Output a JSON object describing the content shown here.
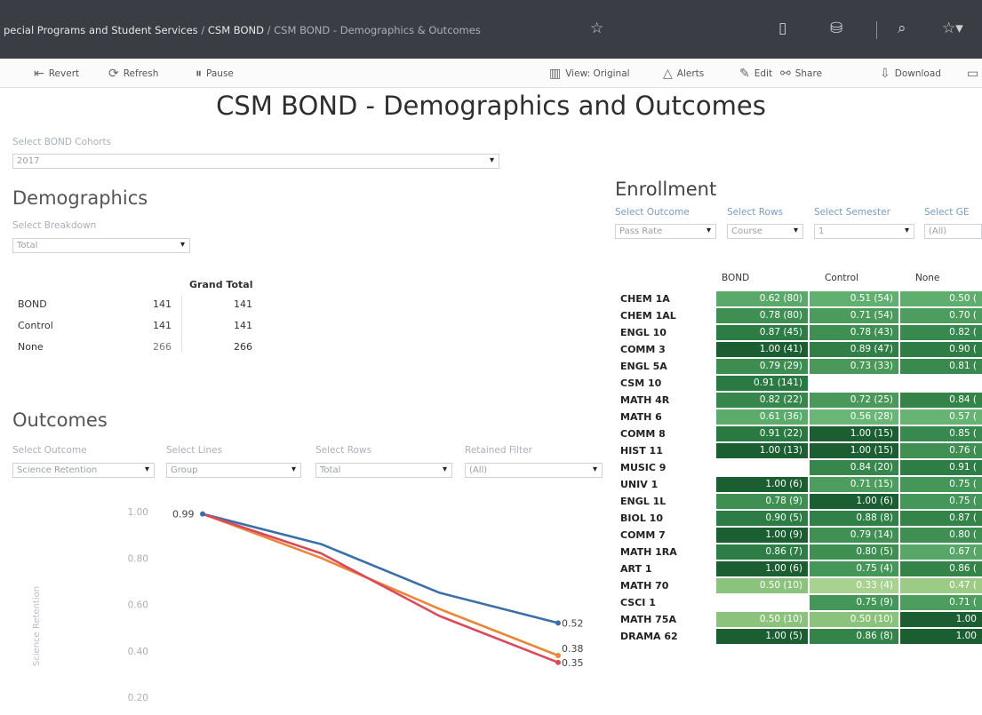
{
  "breadcrumb": {
    "part1": "pecial Programs and Student Services",
    "sep": " / ",
    "part2": "CSM BOND",
    "part3": "CSM BOND - Demographics & Outcomes"
  },
  "toolbar": {
    "revert": "Revert",
    "refresh": "Refresh",
    "pause": "Pause",
    "view_original": "View: Original",
    "alerts": "Alerts",
    "edit": "Edit",
    "share": "Share",
    "download": "Download"
  },
  "title": "CSM BOND - Demographics and Outcomes",
  "cohort_filter": {
    "label": "Select BOND Cohorts",
    "value": "2017"
  },
  "demographics": {
    "title": "Demographics",
    "breakdown_label": "Select Breakdown",
    "breakdown_value": "Total",
    "grand_total_header": "Grand Total",
    "rows": [
      {
        "label": "BOND",
        "value": "141",
        "total": "141"
      },
      {
        "label": "Control",
        "value": "141",
        "total": "141"
      },
      {
        "label": "None",
        "value": "266",
        "total": "266"
      }
    ]
  },
  "outcomes": {
    "title": "Outcomes",
    "filters": [
      {
        "label": "Select Outcome",
        "value": "Science Retention"
      },
      {
        "label": "Select Lines",
        "value": "Group"
      },
      {
        "label": "Select Rows",
        "value": "Total"
      },
      {
        "label": "Retained Filter",
        "value": "(All)"
      }
    ]
  },
  "enrollment": {
    "title": "Enrollment",
    "filters": [
      {
        "label": "Select Outcome",
        "value": "Pass Rate"
      },
      {
        "label": "Select Rows",
        "value": "Course"
      },
      {
        "label": "Select Semester",
        "value": "1"
      },
      {
        "label": "Select GE",
        "value": "(All)"
      }
    ],
    "columns": [
      "BOND",
      "Control",
      "None"
    ],
    "rows": [
      {
        "course": "CHEM 1A",
        "cells": [
          "0.62 (80)",
          "0.51 (54)",
          "0.50 ("
        ]
      },
      {
        "course": "CHEM 1AL",
        "cells": [
          "0.78 (80)",
          "0.71 (54)",
          "0.70 ("
        ]
      },
      {
        "course": "ENGL 10",
        "cells": [
          "0.87 (45)",
          "0.78 (43)",
          "0.82 ("
        ]
      },
      {
        "course": "COMM 3",
        "cells": [
          "1.00 (41)",
          "0.89 (47)",
          "0.90 ("
        ]
      },
      {
        "course": "ENGL 5A",
        "cells": [
          "0.79 (29)",
          "0.73 (33)",
          "0.81 ("
        ]
      },
      {
        "course": "CSM 10",
        "cells": [
          "0.91 (141)",
          "",
          ""
        ]
      },
      {
        "course": "MATH 4R",
        "cells": [
          "0.82 (22)",
          "0.72 (25)",
          "0.84 ("
        ]
      },
      {
        "course": "MATH 6",
        "cells": [
          "0.61 (36)",
          "0.56 (28)",
          "0.57 ("
        ]
      },
      {
        "course": "COMM 8",
        "cells": [
          "0.91 (22)",
          "1.00 (15)",
          "0.85 ("
        ]
      },
      {
        "course": "HIST 11",
        "cells": [
          "1.00 (13)",
          "1.00 (15)",
          "0.76 ("
        ]
      },
      {
        "course": "MUSIC 9",
        "cells": [
          "",
          "0.84 (20)",
          "0.91 ("
        ]
      },
      {
        "course": "UNIV 1",
        "cells": [
          "1.00 (6)",
          "0.71 (15)",
          "0.75 ("
        ]
      },
      {
        "course": "ENGL 1L",
        "cells": [
          "0.78 (9)",
          "1.00 (6)",
          "0.75 ("
        ]
      },
      {
        "course": "BIOL 10",
        "cells": [
          "0.90 (5)",
          "0.88 (8)",
          "0.87 ("
        ]
      },
      {
        "course": "COMM 7",
        "cells": [
          "1.00 (9)",
          "0.79 (14)",
          "0.80 ("
        ]
      },
      {
        "course": "MATH 1RA",
        "cells": [
          "0.86 (7)",
          "0.80 (5)",
          "0.67 ("
        ]
      },
      {
        "course": "ART 1",
        "cells": [
          "1.00 (6)",
          "0.75 (4)",
          "0.86 ("
        ]
      },
      {
        "course": "MATH 70",
        "cells": [
          "0.50 (10)",
          "0.33 (4)",
          "0.47 ("
        ]
      },
      {
        "course": "CSCI 1",
        "cells": [
          "",
          "0.75 (9)",
          "0.71 ("
        ]
      },
      {
        "course": "MATH 75A",
        "cells": [
          "0.50 (10)",
          "0.50 (10)",
          "1.00"
        ]
      },
      {
        "course": "DRAMA 62",
        "cells": [
          "1.00 (5)",
          "0.86 (8)",
          "1.00"
        ]
      }
    ],
    "shades": [
      [
        "#5aa86a",
        "#61b070",
        "#5fae6e"
      ],
      [
        "#3f8f53",
        "#4a9b5c",
        "#4c9d5e"
      ],
      [
        "#2d7c45",
        "#3f8f53",
        "#38894f"
      ],
      [
        "#1b5e31",
        "#317f47",
        "#2f7d46"
      ],
      [
        "#3d8d51",
        "#4a995b",
        "#3a8a50"
      ],
      [
        "#2a7942",
        "#ffffff",
        "#ffffff"
      ],
      [
        "#37874d",
        "#4a995b",
        "#348449"
      ],
      [
        "#5cab6b",
        "#6ab677",
        "#67b374"
      ],
      [
        "#2a7942",
        "#1b5e31",
        "#388950"
      ],
      [
        "#1b5e31",
        "#1b5e31",
        "#409054"
      ],
      [
        "#ffffff",
        "#37874d",
        "#2f7d46"
      ],
      [
        "#1b5e31",
        "#4d9d5f",
        "#459659"
      ],
      [
        "#3f8f53",
        "#1b5e31",
        "#459659"
      ],
      [
        "#2d7c45",
        "#318048",
        "#348449"
      ],
      [
        "#1b5e31",
        "#409054",
        "#3f8f53"
      ],
      [
        "#2f7d46",
        "#3f8f53",
        "#58a768"
      ],
      [
        "#1b5e31",
        "#459659",
        "#34844a"
      ],
      [
        "#8cc37c",
        "#a8d28f",
        "#9ccb86"
      ],
      [
        "#ffffff",
        "#459659",
        "#4d9d5f"
      ],
      [
        "#8cc37c",
        "#8cc37c",
        "#1b5e31"
      ],
      [
        "#1b5e31",
        "#348449",
        "#1b5e31"
      ]
    ]
  },
  "chart_data": {
    "type": "line",
    "ylabel": "Science Retention",
    "yticks": [
      "1.00",
      "0.80",
      "0.60",
      "0.40",
      "0.20"
    ],
    "ylim": [
      0.15,
      1.05
    ],
    "x": [
      1,
      2,
      3,
      4
    ],
    "series": [
      {
        "color": "#3b6fa8",
        "values": [
          0.99,
          0.86,
          0.65,
          0.52
        ]
      },
      {
        "color": "#e8873a",
        "values": [
          0.99,
          0.8,
          0.58,
          0.38
        ]
      },
      {
        "color": "#d94b5c",
        "values": [
          0.99,
          0.82,
          0.55,
          0.35
        ]
      }
    ],
    "labels": {
      "start": "0.99",
      "ends": [
        "0.52",
        "0.38",
        "0.35"
      ]
    }
  }
}
